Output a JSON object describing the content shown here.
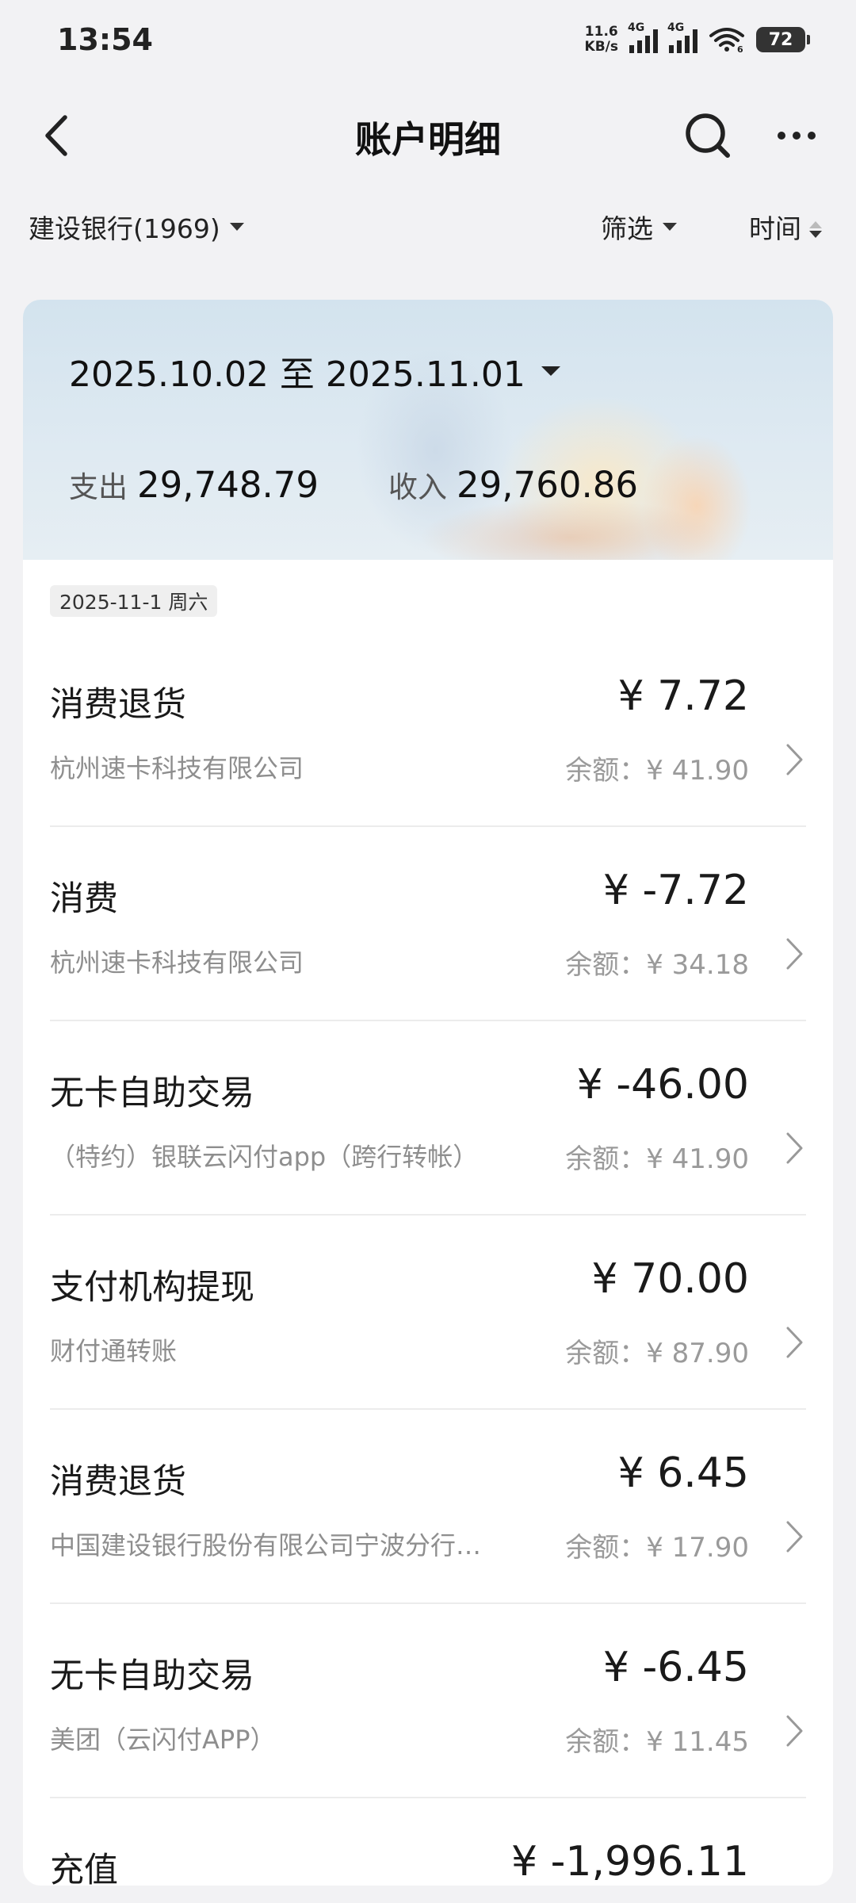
{
  "status_bar": {
    "time": "13:54",
    "net_speed_value": "11.6",
    "net_speed_unit": "KB/s",
    "sim1_label": "4G",
    "sim2_label": "4G",
    "wifi_label": "6",
    "battery": "72"
  },
  "header": {
    "title": "账户明细"
  },
  "filters": {
    "account": "建设银行(1969)",
    "filter_label": "筛选",
    "time_label": "时间"
  },
  "summary": {
    "date_range": "2025.10.02 至 2025.11.01",
    "expense_label": "支出",
    "expense_value": "29,748.79",
    "income_label": "收入",
    "income_value": "29,760.86"
  },
  "date_group": "2025-11-1 周六",
  "transactions": [
    {
      "type": "消费退货",
      "amount": "¥ 7.72",
      "merchant": "杭州速卡科技有限公司",
      "balance": "余额：¥ 41.90"
    },
    {
      "type": "消费",
      "amount": "¥ -7.72",
      "merchant": "杭州速卡科技有限公司",
      "balance": "余额：¥ 34.18"
    },
    {
      "type": "无卡自助交易",
      "amount": "¥ -46.00",
      "merchant": "（特约）银联云闪付app（跨行转帐）",
      "balance": "余额：¥ 41.90"
    },
    {
      "type": "支付机构提现",
      "amount": "¥ 70.00",
      "merchant": "财付通转账",
      "balance": "余额：¥ 87.90"
    },
    {
      "type": "消费退货",
      "amount": "¥ 6.45",
      "merchant": "中国建设银行股份有限公司宁波分行…",
      "balance": "余额：¥ 17.90"
    },
    {
      "type": "无卡自助交易",
      "amount": "¥ -6.45",
      "merchant": "美团（云闪付APP）",
      "balance": "余额：¥ 11.45"
    },
    {
      "type": "充值",
      "amount": "¥ -1,996.11",
      "merchant": "",
      "balance": ""
    }
  ]
}
